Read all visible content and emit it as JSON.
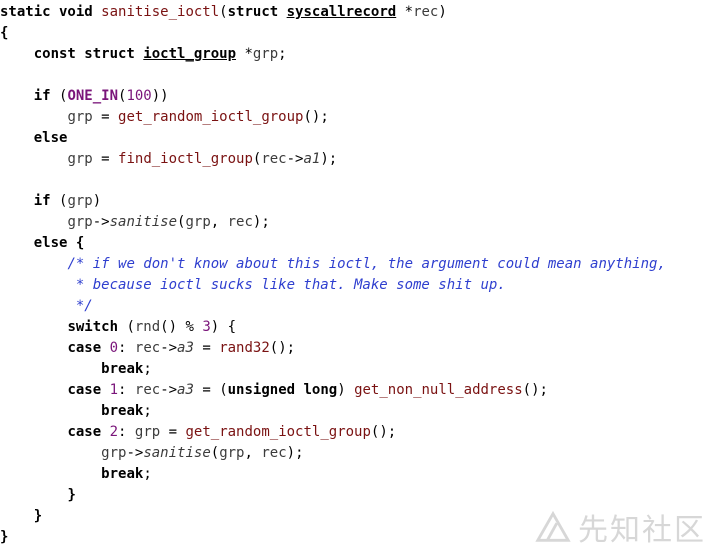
{
  "code_lines": [
    [
      {
        "t": "static void ",
        "c": "kw"
      },
      {
        "t": "sanitise_ioctl",
        "c": "fn"
      },
      {
        "t": "(",
        "c": ""
      },
      {
        "t": "struct ",
        "c": "kw"
      },
      {
        "t": "syscallrecord",
        "c": "kw ul"
      },
      {
        "t": " *",
        "c": ""
      },
      {
        "t": "rec",
        "c": "id"
      },
      {
        "t": ")",
        "c": ""
      }
    ],
    [
      {
        "t": "{",
        "c": "kw"
      }
    ],
    [
      {
        "t": "    ",
        "c": ""
      },
      {
        "t": "const struct ",
        "c": "kw"
      },
      {
        "t": "ioctl_group",
        "c": "kw ul"
      },
      {
        "t": " *",
        "c": ""
      },
      {
        "t": "grp",
        "c": "id"
      },
      {
        "t": ";",
        "c": ""
      }
    ],
    [
      {
        "t": "",
        "c": ""
      }
    ],
    [
      {
        "t": "    ",
        "c": ""
      },
      {
        "t": "if",
        "c": "kw"
      },
      {
        "t": " (",
        "c": ""
      },
      {
        "t": "ONE_IN",
        "c": "macro"
      },
      {
        "t": "(",
        "c": ""
      },
      {
        "t": "100",
        "c": "num"
      },
      {
        "t": "))",
        "c": ""
      }
    ],
    [
      {
        "t": "        ",
        "c": ""
      },
      {
        "t": "grp",
        "c": "id"
      },
      {
        "t": " = ",
        "c": ""
      },
      {
        "t": "get_random_ioctl_group",
        "c": "fn"
      },
      {
        "t": "();",
        "c": ""
      }
    ],
    [
      {
        "t": "    ",
        "c": ""
      },
      {
        "t": "else",
        "c": "kw"
      }
    ],
    [
      {
        "t": "        ",
        "c": ""
      },
      {
        "t": "grp",
        "c": "id"
      },
      {
        "t": " = ",
        "c": ""
      },
      {
        "t": "find_ioctl_group",
        "c": "fn"
      },
      {
        "t": "(",
        "c": ""
      },
      {
        "t": "rec",
        "c": "id"
      },
      {
        "t": "->",
        "c": ""
      },
      {
        "t": "a1",
        "c": "ital"
      },
      {
        "t": ");",
        "c": ""
      }
    ],
    [
      {
        "t": "",
        "c": ""
      }
    ],
    [
      {
        "t": "    ",
        "c": ""
      },
      {
        "t": "if",
        "c": "kw"
      },
      {
        "t": " (",
        "c": ""
      },
      {
        "t": "grp",
        "c": "id"
      },
      {
        "t": ")",
        "c": ""
      }
    ],
    [
      {
        "t": "        ",
        "c": ""
      },
      {
        "t": "grp",
        "c": "id"
      },
      {
        "t": "->",
        "c": ""
      },
      {
        "t": "sanitise",
        "c": "ital"
      },
      {
        "t": "(",
        "c": ""
      },
      {
        "t": "grp",
        "c": "id"
      },
      {
        "t": ", ",
        "c": ""
      },
      {
        "t": "rec",
        "c": "id"
      },
      {
        "t": ");",
        "c": ""
      }
    ],
    [
      {
        "t": "    ",
        "c": ""
      },
      {
        "t": "else",
        "c": "kw"
      },
      {
        "t": " {",
        "c": "kw"
      }
    ],
    [
      {
        "t": "        ",
        "c": ""
      },
      {
        "t": "/* if we don't know about this ioctl, the argument could mean anything,",
        "c": "cmt"
      }
    ],
    [
      {
        "t": "         ",
        "c": ""
      },
      {
        "t": "* because ioctl sucks like that. Make some shit up.",
        "c": "cmt"
      }
    ],
    [
      {
        "t": "         ",
        "c": ""
      },
      {
        "t": "*/",
        "c": "cmt"
      }
    ],
    [
      {
        "t": "        ",
        "c": ""
      },
      {
        "t": "switch",
        "c": "kw"
      },
      {
        "t": " (",
        "c": ""
      },
      {
        "t": "rnd",
        "c": "id"
      },
      {
        "t": "() % ",
        "c": ""
      },
      {
        "t": "3",
        "c": "num"
      },
      {
        "t": ") {",
        "c": ""
      }
    ],
    [
      {
        "t": "        ",
        "c": ""
      },
      {
        "t": "case",
        "c": "kw"
      },
      {
        "t": " ",
        "c": ""
      },
      {
        "t": "0",
        "c": "num"
      },
      {
        "t": ": ",
        "c": ""
      },
      {
        "t": "rec",
        "c": "id"
      },
      {
        "t": "->",
        "c": ""
      },
      {
        "t": "a3",
        "c": "ital"
      },
      {
        "t": " = ",
        "c": ""
      },
      {
        "t": "rand32",
        "c": "fn"
      },
      {
        "t": "();",
        "c": ""
      }
    ],
    [
      {
        "t": "            ",
        "c": ""
      },
      {
        "t": "break",
        "c": "kw"
      },
      {
        "t": ";",
        "c": ""
      }
    ],
    [
      {
        "t": "        ",
        "c": ""
      },
      {
        "t": "case",
        "c": "kw"
      },
      {
        "t": " ",
        "c": ""
      },
      {
        "t": "1",
        "c": "num"
      },
      {
        "t": ": ",
        "c": ""
      },
      {
        "t": "rec",
        "c": "id"
      },
      {
        "t": "->",
        "c": ""
      },
      {
        "t": "a3",
        "c": "ital"
      },
      {
        "t": " = (",
        "c": ""
      },
      {
        "t": "unsigned long",
        "c": "kw"
      },
      {
        "t": ") ",
        "c": ""
      },
      {
        "t": "get_non_null_address",
        "c": "fn"
      },
      {
        "t": "();",
        "c": ""
      }
    ],
    [
      {
        "t": "            ",
        "c": ""
      },
      {
        "t": "break",
        "c": "kw"
      },
      {
        "t": ";",
        "c": ""
      }
    ],
    [
      {
        "t": "        ",
        "c": ""
      },
      {
        "t": "case",
        "c": "kw"
      },
      {
        "t": " ",
        "c": ""
      },
      {
        "t": "2",
        "c": "num"
      },
      {
        "t": ": ",
        "c": ""
      },
      {
        "t": "grp",
        "c": "id"
      },
      {
        "t": " = ",
        "c": ""
      },
      {
        "t": "get_random_ioctl_group",
        "c": "fn"
      },
      {
        "t": "();",
        "c": ""
      }
    ],
    [
      {
        "t": "            ",
        "c": ""
      },
      {
        "t": "grp",
        "c": "id"
      },
      {
        "t": "->",
        "c": ""
      },
      {
        "t": "sanitise",
        "c": "ital"
      },
      {
        "t": "(",
        "c": ""
      },
      {
        "t": "grp",
        "c": "id"
      },
      {
        "t": ", ",
        "c": ""
      },
      {
        "t": "rec",
        "c": "id"
      },
      {
        "t": ");",
        "c": ""
      }
    ],
    [
      {
        "t": "            ",
        "c": ""
      },
      {
        "t": "break",
        "c": "kw"
      },
      {
        "t": ";",
        "c": ""
      }
    ],
    [
      {
        "t": "        ",
        "c": ""
      },
      {
        "t": "}",
        "c": "kw"
      }
    ],
    [
      {
        "t": "    ",
        "c": ""
      },
      {
        "t": "}",
        "c": "kw"
      }
    ],
    [
      {
        "t": "}",
        "c": "kw"
      }
    ]
  ],
  "watermark": {
    "text": "先知社区",
    "icon": "xianzhi-logo-icon"
  }
}
